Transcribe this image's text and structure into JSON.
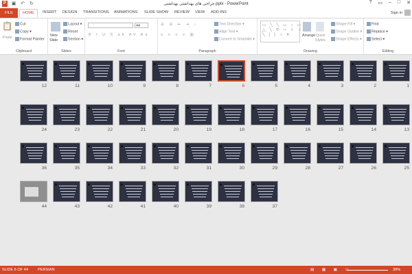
{
  "app": {
    "title": "جراحی های بهداشتی بهداشتی.pptx - PowerPoint",
    "logo": "P"
  },
  "qat": {
    "save_icon": "save-icon",
    "undo_icon": "undo-icon",
    "redo_icon": "redo-icon"
  },
  "window": {
    "help": "?",
    "restore": "▭",
    "minimize": "–",
    "maximize": "□",
    "close": "✕"
  },
  "tabs": [
    "FILE",
    "HOME",
    "INSERT",
    "DESIGN",
    "TRANSITIONS",
    "ANIMATIONS",
    "SLIDE SHOW",
    "REVIEW",
    "VIEW",
    "ADD-INS"
  ],
  "account": {
    "signin": "Sign in"
  },
  "ribbon": {
    "clipboard": {
      "label": "Clipboard",
      "paste": "Paste",
      "cut": "Cut",
      "copy": "Copy",
      "format_painter": "Format Painter"
    },
    "slides": {
      "label": "Slides",
      "new_slide": "New",
      "new_slide2": "Slide",
      "layout": "Layout",
      "reset": "Reset",
      "section": "Section"
    },
    "font": {
      "label": "Font",
      "size": "44"
    },
    "paragraph": {
      "label": "Paragraph",
      "text_direction": "Text Direction",
      "align_text": "Align Text",
      "convert": "Convert to SmartArt"
    },
    "drawing": {
      "label": "Drawing",
      "arrange": "Arrange",
      "quick_styles": "Quick",
      "quick_styles2": "Styles",
      "shape_fill": "Shape Fill",
      "shape_outline": "Shape Outline",
      "shape_effects": "Shape Effects"
    },
    "editing": {
      "label": "Editing",
      "find": "Find",
      "replace": "Replace",
      "select": "Select"
    }
  },
  "slides": [
    {
      "n": "12"
    },
    {
      "n": "11"
    },
    {
      "n": "10"
    },
    {
      "n": "9"
    },
    {
      "n": "8"
    },
    {
      "n": "7"
    },
    {
      "n": "6",
      "selected": true
    },
    {
      "n": "5"
    },
    {
      "n": "4"
    },
    {
      "n": "3"
    },
    {
      "n": "2"
    },
    {
      "n": "1"
    },
    {
      "n": "24"
    },
    {
      "n": "23"
    },
    {
      "n": "22"
    },
    {
      "n": "21"
    },
    {
      "n": "20"
    },
    {
      "n": "19"
    },
    {
      "n": "18"
    },
    {
      "n": "17"
    },
    {
      "n": "16"
    },
    {
      "n": "15"
    },
    {
      "n": "14"
    },
    {
      "n": "13"
    },
    {
      "n": "36"
    },
    {
      "n": "35"
    },
    {
      "n": "34"
    },
    {
      "n": "33"
    },
    {
      "n": "32"
    },
    {
      "n": "31"
    },
    {
      "n": "30"
    },
    {
      "n": "29"
    },
    {
      "n": "28"
    },
    {
      "n": "27"
    },
    {
      "n": "26"
    },
    {
      "n": "25"
    },
    {
      "n": "44",
      "photo": true
    },
    {
      "n": "43"
    },
    {
      "n": "42"
    },
    {
      "n": "41"
    },
    {
      "n": "40"
    },
    {
      "n": "39"
    },
    {
      "n": "38"
    },
    {
      "n": "37"
    }
  ],
  "status": {
    "slide": "SLIDE 6 OF 44",
    "lang": "PERSIAN",
    "zoom": "38%"
  },
  "colors": {
    "accent": "#d24726"
  }
}
